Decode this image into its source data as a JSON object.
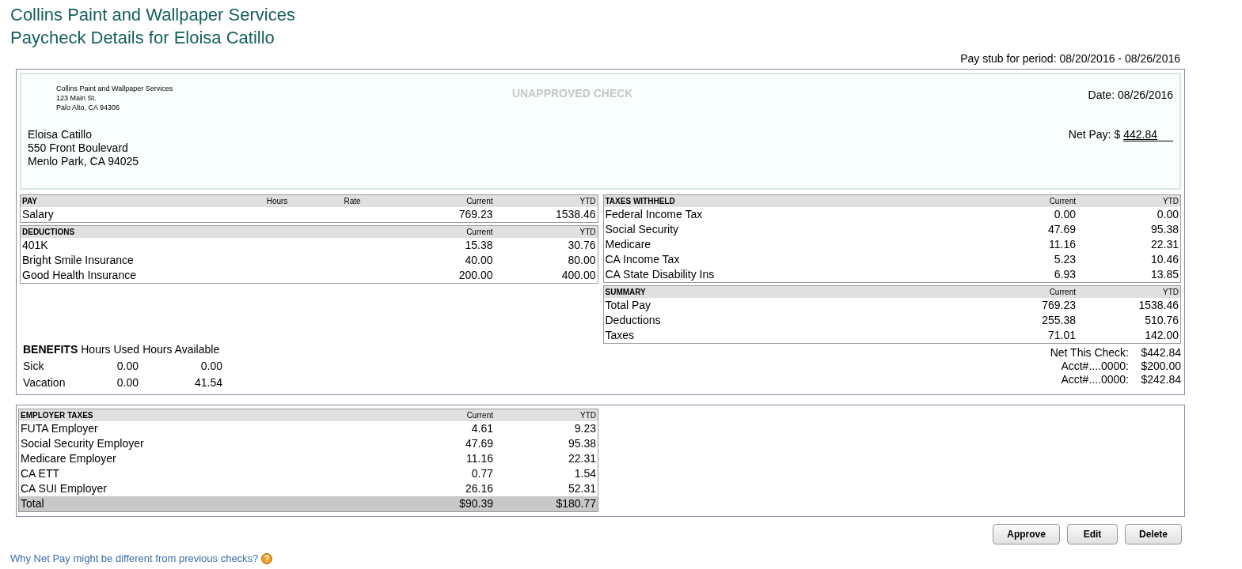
{
  "header": {
    "company": "Collins Paint and Wallpaper Services",
    "title": "Paycheck Details for Eloisa Catillo",
    "period": "Pay stub for period: 08/20/2016 - 08/26/2016"
  },
  "check": {
    "company_lines": [
      "Collins Paint and Wallpaper Services",
      "123 Main St.",
      "Palo Alto, CA 94306"
    ],
    "status": "UNAPPROVED CHECK",
    "date": "Date: 08/26/2016",
    "payee_lines": [
      "Eloisa Catillo",
      "550 Front Boulevard",
      "Menlo Park, CA 94025"
    ],
    "net_pay_label": "Net Pay: $",
    "net_pay_amount": "442.84"
  },
  "pay": {
    "title": "PAY",
    "extra_columns": [
      "Hours",
      "Rate"
    ],
    "current": "Current",
    "ytd": "YTD",
    "rows": [
      {
        "label": "Salary",
        "current": "769.23",
        "ytd": "1538.46"
      }
    ]
  },
  "deductions": {
    "title": "DEDUCTIONS",
    "current": "Current",
    "ytd": "YTD",
    "rows": [
      {
        "label": "401K",
        "current": "15.38",
        "ytd": "30.76"
      },
      {
        "label": "Bright Smile Insurance",
        "current": "40.00",
        "ytd": "80.00"
      },
      {
        "label": "Good Health Insurance",
        "current": "200.00",
        "ytd": "400.00"
      }
    ]
  },
  "benefits": {
    "title": "BENEFITS",
    "columns": [
      "Hours Used",
      "Hours Available"
    ],
    "rows": [
      {
        "label": "Sick",
        "used": "0.00",
        "available": "0.00"
      },
      {
        "label": "Vacation",
        "used": "0.00",
        "available": "41.54"
      }
    ]
  },
  "taxes_withheld": {
    "title": "TAXES WITHHELD",
    "current": "Current",
    "ytd": "YTD",
    "rows": [
      {
        "label": "Federal Income Tax",
        "current": "0.00",
        "ytd": "0.00"
      },
      {
        "label": "Social Security",
        "current": "47.69",
        "ytd": "95.38"
      },
      {
        "label": "Medicare",
        "current": "11.16",
        "ytd": "22.31"
      },
      {
        "label": "CA Income Tax",
        "current": "5.23",
        "ytd": "10.46"
      },
      {
        "label": "CA State Disability Ins",
        "current": "6.93",
        "ytd": "13.85"
      }
    ]
  },
  "summary": {
    "title": "SUMMARY",
    "current": "Current",
    "ytd": "YTD",
    "rows": [
      {
        "label": "Total Pay",
        "current": "769.23",
        "ytd": "1538.46"
      },
      {
        "label": "Deductions",
        "current": "255.38",
        "ytd": "510.76"
      },
      {
        "label": "Taxes",
        "current": "71.01",
        "ytd": "142.00"
      }
    ]
  },
  "net_lines": [
    {
      "label": "Net This Check:",
      "amount": "$442.84"
    },
    {
      "label": "Acct#....0000:",
      "amount": "$200.00"
    },
    {
      "label": "Acct#....0000:",
      "amount": "$242.84"
    }
  ],
  "employer_taxes": {
    "title": "EMPLOYER TAXES",
    "current": "Current",
    "ytd": "YTD",
    "rows": [
      {
        "label": "FUTA Employer",
        "current": "4.61",
        "ytd": "9.23"
      },
      {
        "label": "Social Security Employer",
        "current": "47.69",
        "ytd": "95.38"
      },
      {
        "label": "Medicare Employer",
        "current": "11.16",
        "ytd": "22.31"
      },
      {
        "label": "CA ETT",
        "current": "0.77",
        "ytd": "1.54"
      },
      {
        "label": "CA SUI Employer",
        "current": "26.16",
        "ytd": "52.31"
      }
    ],
    "total": {
      "label": "Total",
      "current": "$90.39",
      "ytd": "$180.77"
    }
  },
  "buttons": [
    "Approve",
    "Edit",
    "Delete"
  ],
  "help_link": "Why Net Pay might be different from previous checks?"
}
